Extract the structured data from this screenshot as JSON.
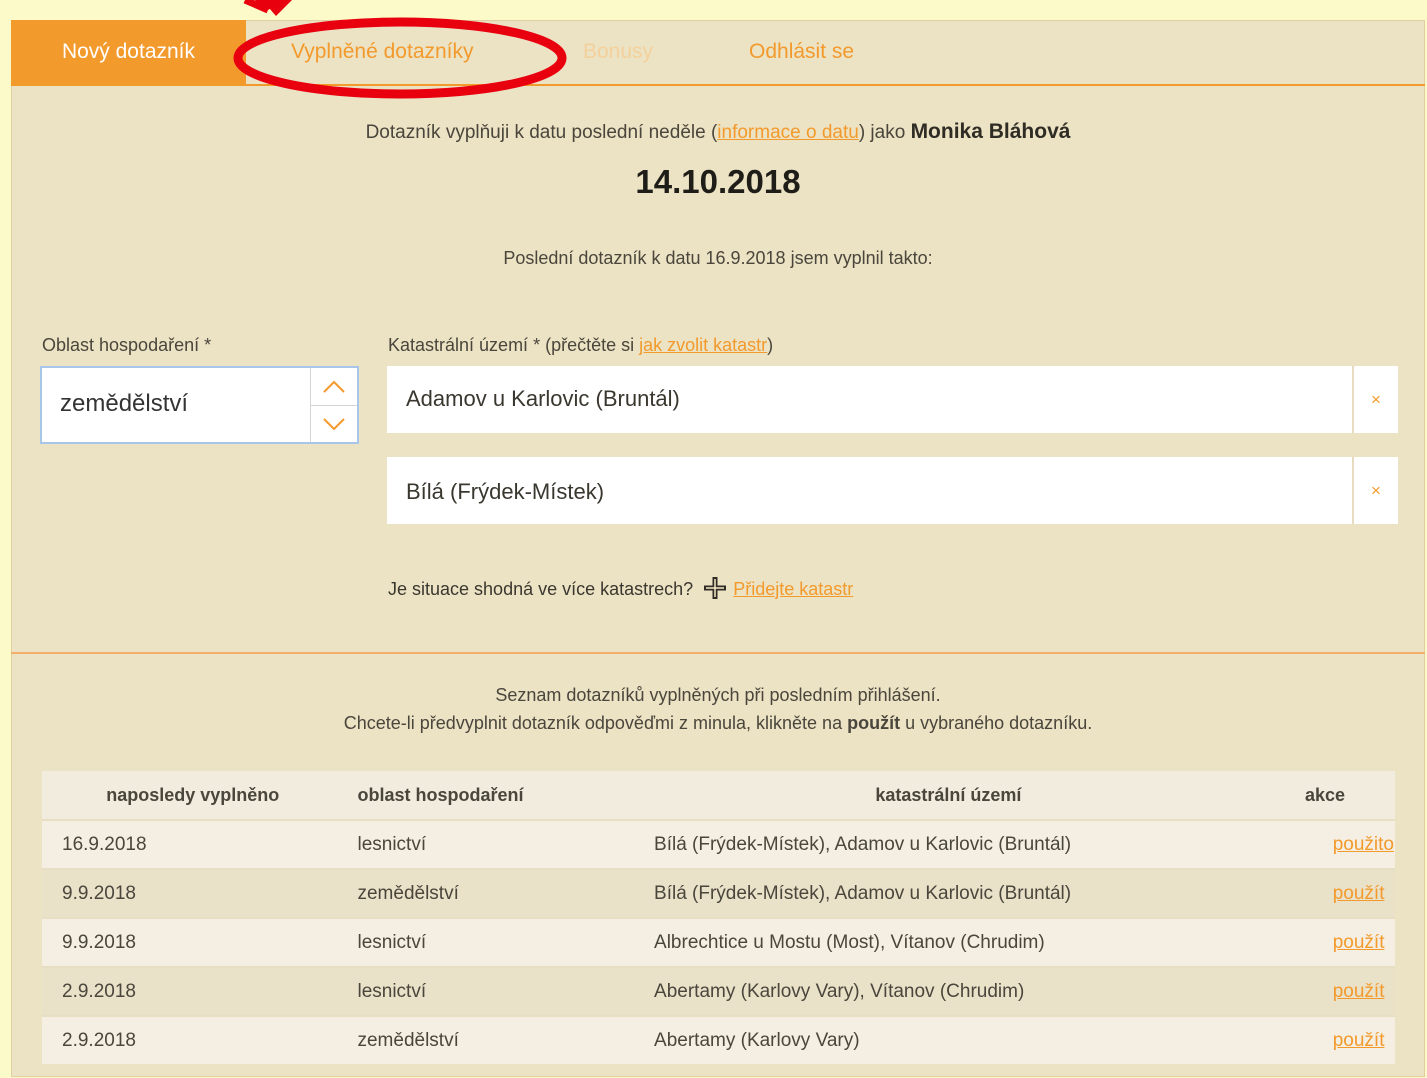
{
  "tabs": [
    {
      "label": "Nový dotazník",
      "active": true
    },
    {
      "label": "Vyplněné dotazníky",
      "active": false
    },
    {
      "label": "Bonusy",
      "active": false,
      "faded": true
    },
    {
      "label": "Odhlásit se",
      "active": false
    }
  ],
  "intro": {
    "before": "Dotazník vyplňuji k datu poslední neděle (",
    "link": "informace o datu",
    "after": ") jako",
    "user": "Monika Bláhová"
  },
  "date": "14.10.2018",
  "last_note": "Poslední dotazník k datu 16.9.2018 jsem vyplnil takto:",
  "oblast": {
    "label": "Oblast hospodaření *",
    "value": "zemědělství"
  },
  "katastr": {
    "label_before": "Katastrální území * (přečtěte si ",
    "label_link": "jak zvolit katastr",
    "label_after": ")",
    "items": [
      "Adamov u Karlovic (Bruntál)",
      "Bílá (Frýdek-Místek)"
    ],
    "remove_symbol": "×"
  },
  "add": {
    "question": "Je situace shodná ve více katastrech?",
    "link": "Přidejte katastr"
  },
  "list_intro": {
    "line1": "Seznam dotazníků vyplněných při posledním přihlášení.",
    "line2_before": "Chcete-li předvyplnit dotazník odpověďmi z minula, klikněte na ",
    "line2_bold": "použít",
    "line2_after": " u vybraného dotazníku."
  },
  "table": {
    "headers": [
      "naposledy vyplněno",
      "oblast hospodaření",
      "katastrální území",
      "akce"
    ],
    "rows": [
      {
        "date": "16.9.2018",
        "area": "lesnictví",
        "katastr": "Bílá (Frýdek-Místek), Adamov u Karlovic (Bruntál)",
        "action": "použito"
      },
      {
        "date": "9.9.2018",
        "area": "zemědělství",
        "katastr": "Bílá (Frýdek-Místek), Adamov u Karlovic (Bruntál)",
        "action": "použít"
      },
      {
        "date": "9.9.2018",
        "area": "lesnictví",
        "katastr": "Albrechtice u Mostu (Most), Vítanov (Chrudim)",
        "action": "použít"
      },
      {
        "date": "2.9.2018",
        "area": "lesnictví",
        "katastr": "Abertamy (Karlovy Vary), Vítanov (Chrudim)",
        "action": "použít"
      },
      {
        "date": "2.9.2018",
        "area": "zemědělství",
        "katastr": "Abertamy (Karlovy Vary)",
        "action": "použít"
      }
    ]
  },
  "colors": {
    "accent": "#f39a2c",
    "panel": "#ece2c4",
    "annotation": "#e8000f"
  },
  "icons": {
    "spinner_up": "chevron-up-icon",
    "spinner_down": "chevron-down-icon",
    "add": "plus-icon",
    "annotation": "annotation-arrow-icon"
  }
}
